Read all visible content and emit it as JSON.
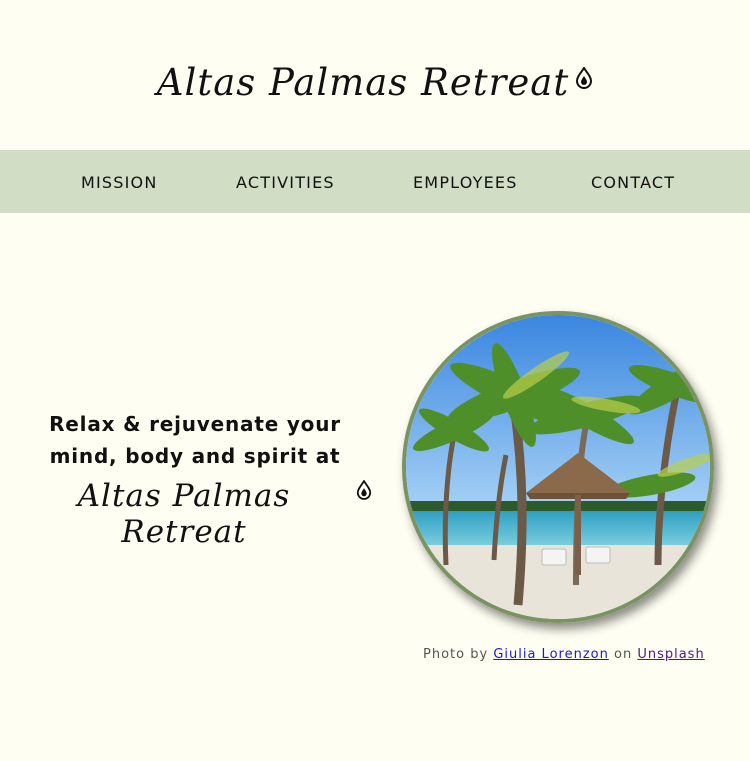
{
  "header": {
    "title": "Altas Palmas Retreat",
    "logo_icon": "water-drop-icon"
  },
  "nav": {
    "items": [
      {
        "label": "MISSION"
      },
      {
        "label": "ACTIVITIES"
      },
      {
        "label": "EMPLOYEES"
      },
      {
        "label": "CONTACT"
      }
    ]
  },
  "hero": {
    "tagline": "Relax & rejuvenate your mind, body and spirit at",
    "brand": "Altas Palmas Retreat",
    "photo_alt": "Palm trees and a thatched umbrella with two lounge chairs on a tropical beach"
  },
  "credit": {
    "prefix": "Photo by",
    "author": "Giulia Lorenzon",
    "middle": "on",
    "site": "Unsplash"
  },
  "colors": {
    "background": "#fefef2",
    "nav_bg": "#d1ddc4",
    "photo_border": "#7a9363",
    "link": "#1a1acc"
  }
}
